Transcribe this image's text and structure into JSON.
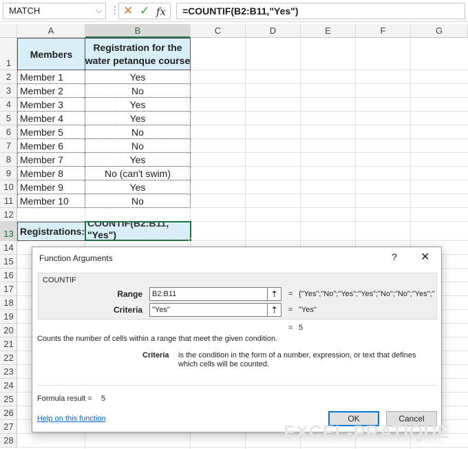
{
  "formula_bar": {
    "name_box": "MATCH",
    "formula": "=COUNTIF(B2:B11,\"Yes\")"
  },
  "columns": [
    "A",
    "B",
    "C",
    "D",
    "E",
    "F",
    "G"
  ],
  "rows": [
    "1",
    "2",
    "3",
    "4",
    "5",
    "6",
    "7",
    "8",
    "9",
    "10",
    "11",
    "12",
    "13",
    "14",
    "15",
    "16",
    "17",
    "18",
    "19",
    "20",
    "21",
    "22",
    "23",
    "24",
    "25",
    "26",
    "27",
    "28"
  ],
  "table": {
    "headers": [
      "Members",
      "Registration for the water petanque course"
    ],
    "header_b_line1": "Registration for the",
    "header_b_line2": "water petanque course",
    "rows": [
      [
        "Member 1",
        "Yes"
      ],
      [
        "Member 2",
        "No"
      ],
      [
        "Member 3",
        "Yes"
      ],
      [
        "Member 4",
        "Yes"
      ],
      [
        "Member 5",
        "No"
      ],
      [
        "Member 6",
        "No"
      ],
      [
        "Member 7",
        "Yes"
      ],
      [
        "Member 8",
        "No (can't swim)"
      ],
      [
        "Member 9",
        "Yes"
      ],
      [
        "Member 10",
        "No"
      ]
    ],
    "registration_label": "Registrations:",
    "registration_cell_clipped": "COUNTIF(B2:B11,",
    "registration_cell_line2": "\"Yes\")"
  },
  "dialog": {
    "title": "Function Arguments",
    "help_glyph": "?",
    "close_glyph": "✕",
    "function_name": "COUNTIF",
    "args": [
      {
        "label": "Range",
        "value": "B2:B11",
        "result": "{\"Yes\";\"No\";\"Yes\";\"Yes\";\"No\";\"No\";\"Yes\";\""
      },
      {
        "label": "Criteria",
        "value": "\"Yes\"",
        "result": "\"Yes\""
      }
    ],
    "equals": "=",
    "total_result": "5",
    "description": "Counts the number of cells within a range that meet the given condition.",
    "arg_help_label": "Criteria",
    "arg_help_line1": "is the condition in the form of a number, expression, or text that defines",
    "arg_help_line2": "which cells will be counted.",
    "formula_result_label": "Formula result =",
    "formula_result_value": "5",
    "help_link": "Help on this function",
    "ok_label": "OK",
    "cancel_label": "Cancel"
  },
  "watermark": "EXCEL-PRATIQUE",
  "colors": {
    "header_fill": "#daeef8",
    "selection_green": "#217346",
    "ok_border": "#0078d7",
    "link": "#0066cc"
  }
}
